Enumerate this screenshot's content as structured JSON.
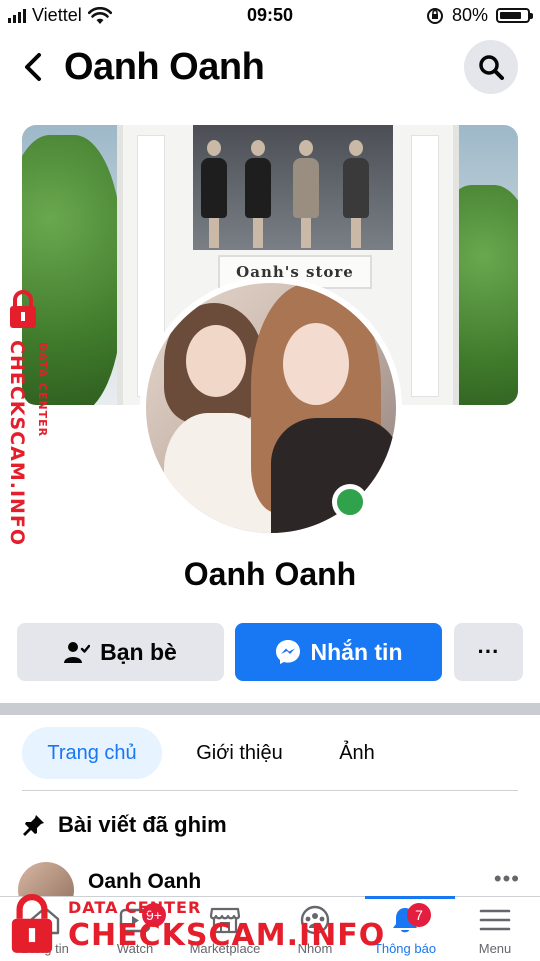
{
  "status_bar": {
    "carrier": "Viettel",
    "time": "09:50",
    "battery": "80%",
    "battery_level": 0.8
  },
  "header": {
    "title": "Oanh Oanh",
    "back_icon": "chevron-left-icon",
    "search_icon": "search-icon"
  },
  "cover": {
    "sign_text": "Oanh's store"
  },
  "profile": {
    "name": "Oanh Oanh",
    "online": true
  },
  "actions": {
    "friends_label": "Bạn bè",
    "message_label": "Nhắn tin",
    "more_label": "···"
  },
  "tabs": [
    {
      "label": "Trang chủ",
      "active": true
    },
    {
      "label": "Giới thiệu",
      "active": false
    },
    {
      "label": "Ảnh",
      "active": false
    }
  ],
  "pinned": {
    "label": "Bài viết đã ghim"
  },
  "post": {
    "author": "Oanh Oanh",
    "more": "•••"
  },
  "bottom_nav": [
    {
      "label": "Bảng tin",
      "icon": "home-icon",
      "badge": ""
    },
    {
      "label": "Watch",
      "icon": "watch-icon",
      "badge": "9+"
    },
    {
      "label": "Marketplace",
      "icon": "marketplace-icon",
      "badge": ""
    },
    {
      "label": "Nhóm",
      "icon": "groups-icon",
      "badge": ""
    },
    {
      "label": "Thông báo",
      "icon": "bell-icon",
      "badge": "7",
      "active": true
    },
    {
      "label": "Menu",
      "icon": "menu-icon",
      "badge": ""
    }
  ],
  "watermark": {
    "brand": "CHECKSCAM.INFO",
    "sub": "DATA CENTER"
  },
  "colors": {
    "accent": "#1877f2",
    "badge": "#e41e3f",
    "online": "#31a24c",
    "watermark": "#e41e2b"
  }
}
